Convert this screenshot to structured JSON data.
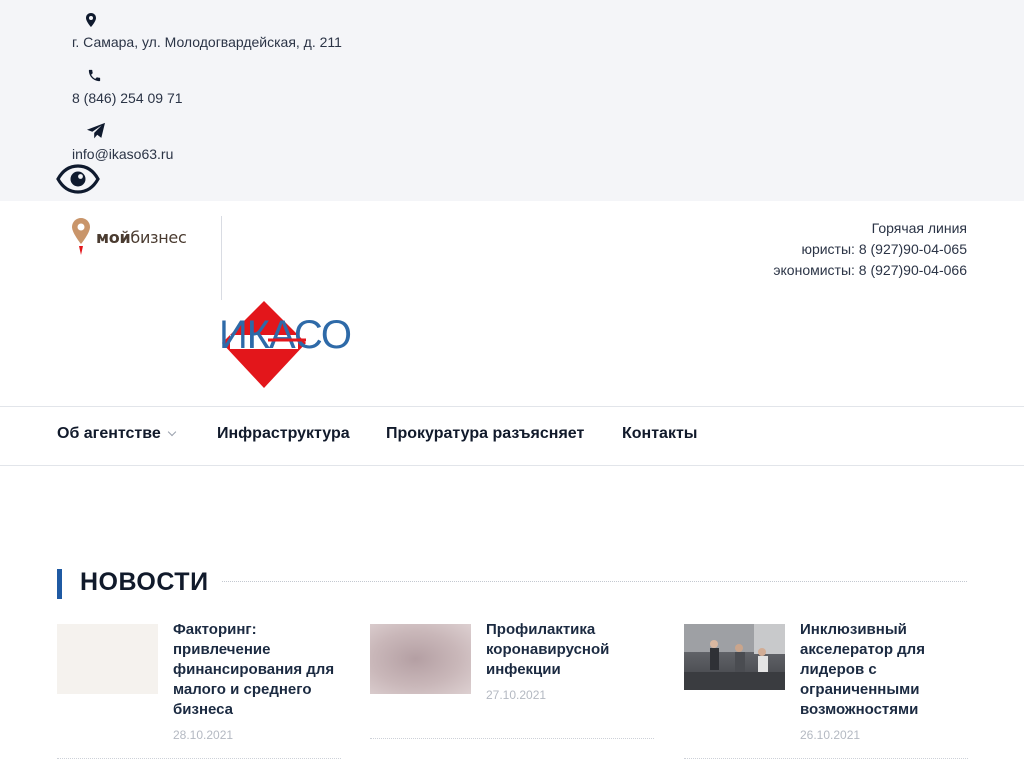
{
  "contacts": {
    "address": "г. Самара, ул. Молодогвардейская, д. 211",
    "phone": "8 (846) 254 09 71",
    "email": "info@ikaso63.ru"
  },
  "header": {
    "hotline_title": "Горячая линия",
    "hotline_lawyers": "юристы: 8 (927)90-04-065",
    "hotline_economists": "экономисты: 8 (927)90-04-066",
    "logo_mb_bold": "мой",
    "logo_mb_light": "бизнес",
    "logo_ikaso": "ИКАСО"
  },
  "nav": {
    "items": [
      {
        "label": "Об агентстве"
      },
      {
        "label": "Инфраструктура"
      },
      {
        "label": "Прокуратура разъясняет"
      },
      {
        "label": "Контакты"
      }
    ]
  },
  "news": {
    "heading": "НОВОСТИ",
    "items": [
      {
        "title": "Факторинг: привлечение финансирования для малого и среднего бизнеса",
        "date": "28.10.2021"
      },
      {
        "title": "Профилактика коронавирусной инфекции",
        "date": "27.10.2021"
      },
      {
        "title": "Инклюзивный акселератор для лидеров с ограниченными возможностями",
        "date": "26.10.2021"
      }
    ]
  },
  "colors": {
    "accent": "#1f5aa3",
    "ikaso_red": "#e3161b",
    "ikaso_blue": "#2e6aa8",
    "topbar_bg": "#f4f5f8"
  }
}
